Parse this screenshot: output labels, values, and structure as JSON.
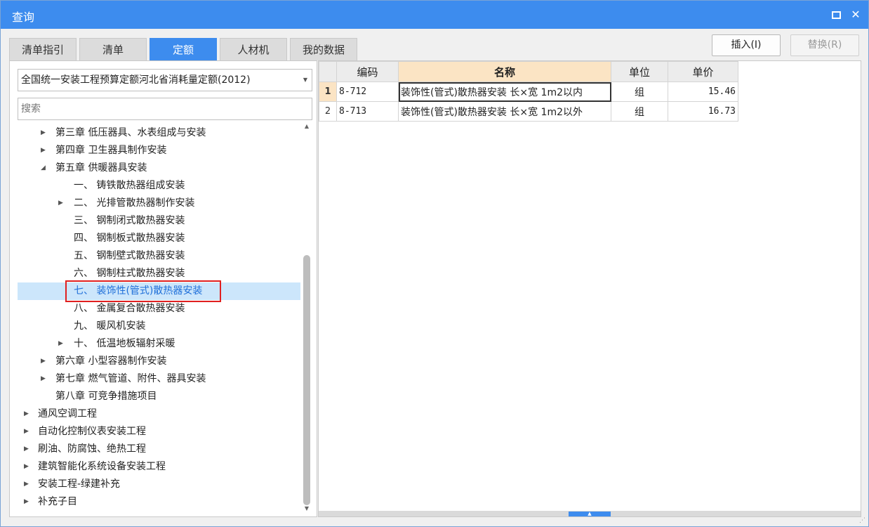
{
  "window": {
    "title": "查询",
    "maximize_label": "□",
    "close_label": "✕"
  },
  "tabs": [
    {
      "label": "清单指引",
      "active": false
    },
    {
      "label": "清单",
      "active": false
    },
    {
      "label": "定额",
      "active": true
    },
    {
      "label": "人材机",
      "active": false
    },
    {
      "label": "我的数据",
      "active": false
    }
  ],
  "buttons": {
    "insert_label": "插入(I)",
    "replace_label": "替换(R)"
  },
  "left": {
    "library_select": "全国统一安装工程预算定额河北省消耗量定额(2012)",
    "search_placeholder": "搜索",
    "tree": [
      {
        "label": "第三章 低压器具、水表组成与安装",
        "expander": "collapsed"
      },
      {
        "label": "第四章 卫生器具制作安装",
        "expander": "collapsed"
      },
      {
        "label": "第五章 供暖器具安装",
        "expander": "expanded"
      },
      {
        "label": "一、 铸铁散热器组成安装",
        "expander": "none"
      },
      {
        "label": "二、 光排管散热器制作安装",
        "expander": "collapsed"
      },
      {
        "label": "三、 钢制闭式散热器安装",
        "expander": "none"
      },
      {
        "label": "四、 钢制板式散热器安装",
        "expander": "none"
      },
      {
        "label": "五、 钢制壁式散热器安装",
        "expander": "none"
      },
      {
        "label": "六、 钢制柱式散热器安装",
        "expander": "none"
      },
      {
        "label": "七、 装饰性(管式)散热器安装",
        "expander": "none",
        "selected": true
      },
      {
        "label": "八、 金属复合散热器安装",
        "expander": "none"
      },
      {
        "label": "九、 暖风机安装",
        "expander": "none"
      },
      {
        "label": "十、 低温地板辐射采暖",
        "expander": "collapsed"
      },
      {
        "label": "第六章 小型容器制作安装",
        "expander": "collapsed"
      },
      {
        "label": "第七章 燃气管道、附件、器具安装",
        "expander": "collapsed"
      },
      {
        "label": "第八章 可竞争措施项目",
        "expander": "none"
      },
      {
        "label": "通风空调工程",
        "expander": "collapsed"
      },
      {
        "label": "自动化控制仪表安装工程",
        "expander": "collapsed"
      },
      {
        "label": "刷油、防腐蚀、绝热工程",
        "expander": "collapsed"
      },
      {
        "label": "建筑智能化系统设备安装工程",
        "expander": "collapsed"
      },
      {
        "label": "安装工程-绿建补充",
        "expander": "collapsed"
      },
      {
        "label": "补充子目",
        "expander": "collapsed"
      }
    ]
  },
  "grid": {
    "columns": [
      "编码",
      "名称",
      "单位",
      "单价"
    ],
    "rows": [
      {
        "num": "1",
        "code": "8-712",
        "name": "装饰性(管式)散热器安装 长×宽 1m2以内",
        "unit": "组",
        "price": "15.46"
      },
      {
        "num": "2",
        "code": "8-713",
        "name": "装饰性(管式)散热器安装 长×宽 1m2以外",
        "unit": "组",
        "price": "16.73"
      }
    ]
  },
  "colors": {
    "accent": "#3d8cee",
    "selected_row": "#cce6fb",
    "name_header": "#fbe4c4",
    "highlight_box": "#e02020"
  }
}
